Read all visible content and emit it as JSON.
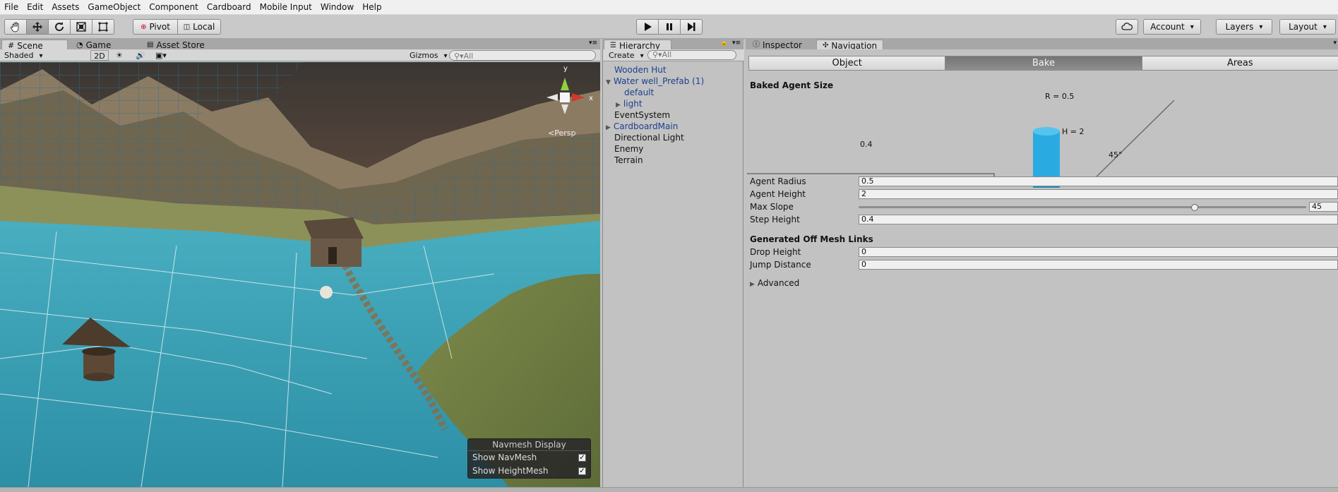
{
  "menu": [
    "File",
    "Edit",
    "Assets",
    "GameObject",
    "Component",
    "Cardboard",
    "Mobile Input",
    "Window",
    "Help"
  ],
  "toolbar": {
    "tools": [
      "hand-icon",
      "move-icon",
      "rotate-icon",
      "scale-icon",
      "rect-icon"
    ],
    "pivot_label": "Pivot",
    "local_label": "Local",
    "account_label": "Account",
    "layers_label": "Layers",
    "layout_label": "Layout"
  },
  "scene_tabs": [
    "Scene",
    "Game",
    "Asset Store"
  ],
  "scene_bar": {
    "shading": "Shaded",
    "mode_2d": "2D",
    "gizmos": "Gizmos",
    "search_placeholder": "All"
  },
  "gizmo": {
    "y_label": "y",
    "x_label": "x",
    "persp_label": "Persp"
  },
  "navmesh_display": {
    "title": "Navmesh Display",
    "show_navmesh": "Show NavMesh",
    "show_heightmesh": "Show HeightMesh",
    "show_navmesh_checked": true,
    "show_heightmesh_checked": true
  },
  "hierarchy": {
    "tab": "Hierarchy",
    "create_label": "Create",
    "search_placeholder": "All",
    "items": [
      {
        "label": "Wooden Hut"
      },
      {
        "label": "Water well_Prefab (1)"
      },
      {
        "label": "default"
      },
      {
        "label": "light"
      },
      {
        "label": "EventSystem"
      },
      {
        "label": "CardboardMain"
      },
      {
        "label": "Directional Light"
      },
      {
        "label": "Enemy"
      },
      {
        "label": "Terrain"
      }
    ]
  },
  "inspector_tabs": [
    "Inspector",
    "Navigation"
  ],
  "navigation": {
    "segments": [
      "Object",
      "Bake",
      "Areas"
    ],
    "selected_segment": "Bake",
    "baked_agent_size": "Baked Agent Size",
    "diagram": {
      "r_label": "R = 0.5",
      "h_label": "H = 2",
      "step_label": "0.4",
      "slope_label": "45°"
    },
    "fields": {
      "agent_radius": {
        "label": "Agent Radius",
        "value": "0.5"
      },
      "agent_height": {
        "label": "Agent Height",
        "value": "2"
      },
      "max_slope": {
        "label": "Max Slope",
        "value": "45",
        "max": 60
      },
      "step_height": {
        "label": "Step Height",
        "value": "0.4"
      }
    },
    "offmesh_header": "Generated Off Mesh Links",
    "offmesh": {
      "drop_height": {
        "label": "Drop Height",
        "value": "0"
      },
      "jump_distance": {
        "label": "Jump Distance",
        "value": "0"
      }
    },
    "advanced": "Advanced"
  },
  "colors": {
    "navmesh": "#3bb5c9",
    "agent_cylinder": "#29abe2",
    "hierarchy_blue": "#1d3f8f"
  }
}
